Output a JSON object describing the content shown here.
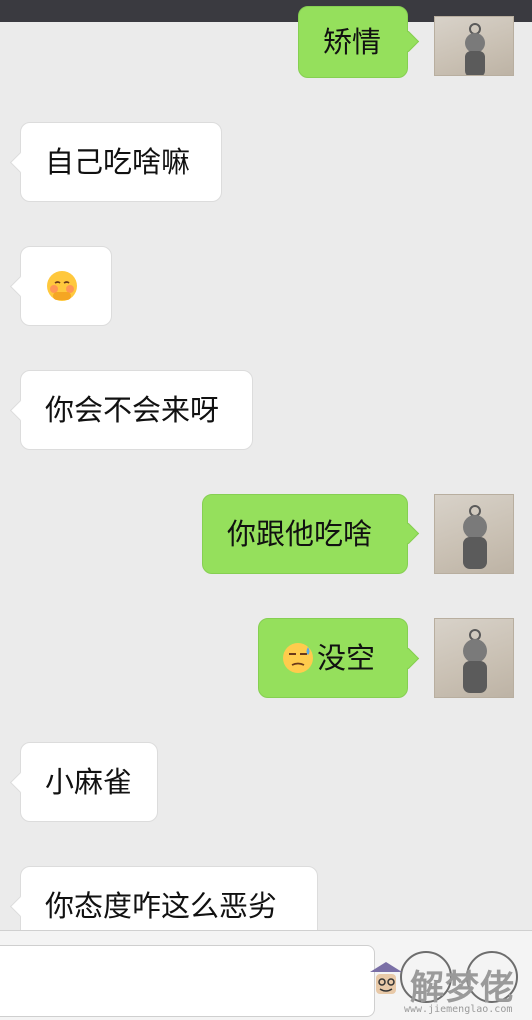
{
  "chat": {
    "messages": [
      {
        "side": "out",
        "text": "矫情"
      },
      {
        "side": "in",
        "text": "自己吃啥嘛"
      },
      {
        "side": "in",
        "text": "",
        "emoji": "flushed-face-emoji"
      },
      {
        "side": "in",
        "text": "你会不会来呀"
      },
      {
        "side": "out",
        "text": "你跟他吃啥"
      },
      {
        "side": "out",
        "text": "没空",
        "emoji": "sweat-face-emoji"
      },
      {
        "side": "in",
        "text": "小麻雀"
      },
      {
        "side": "in",
        "text": "你态度咋这么恶劣"
      }
    ]
  },
  "watermark": {
    "brand_text": "解梦佬",
    "url": "www.jiemenglao.com"
  },
  "colors": {
    "background": "#ebebeb",
    "bubble_out": "#95e05c",
    "bubble_in": "#ffffff"
  }
}
